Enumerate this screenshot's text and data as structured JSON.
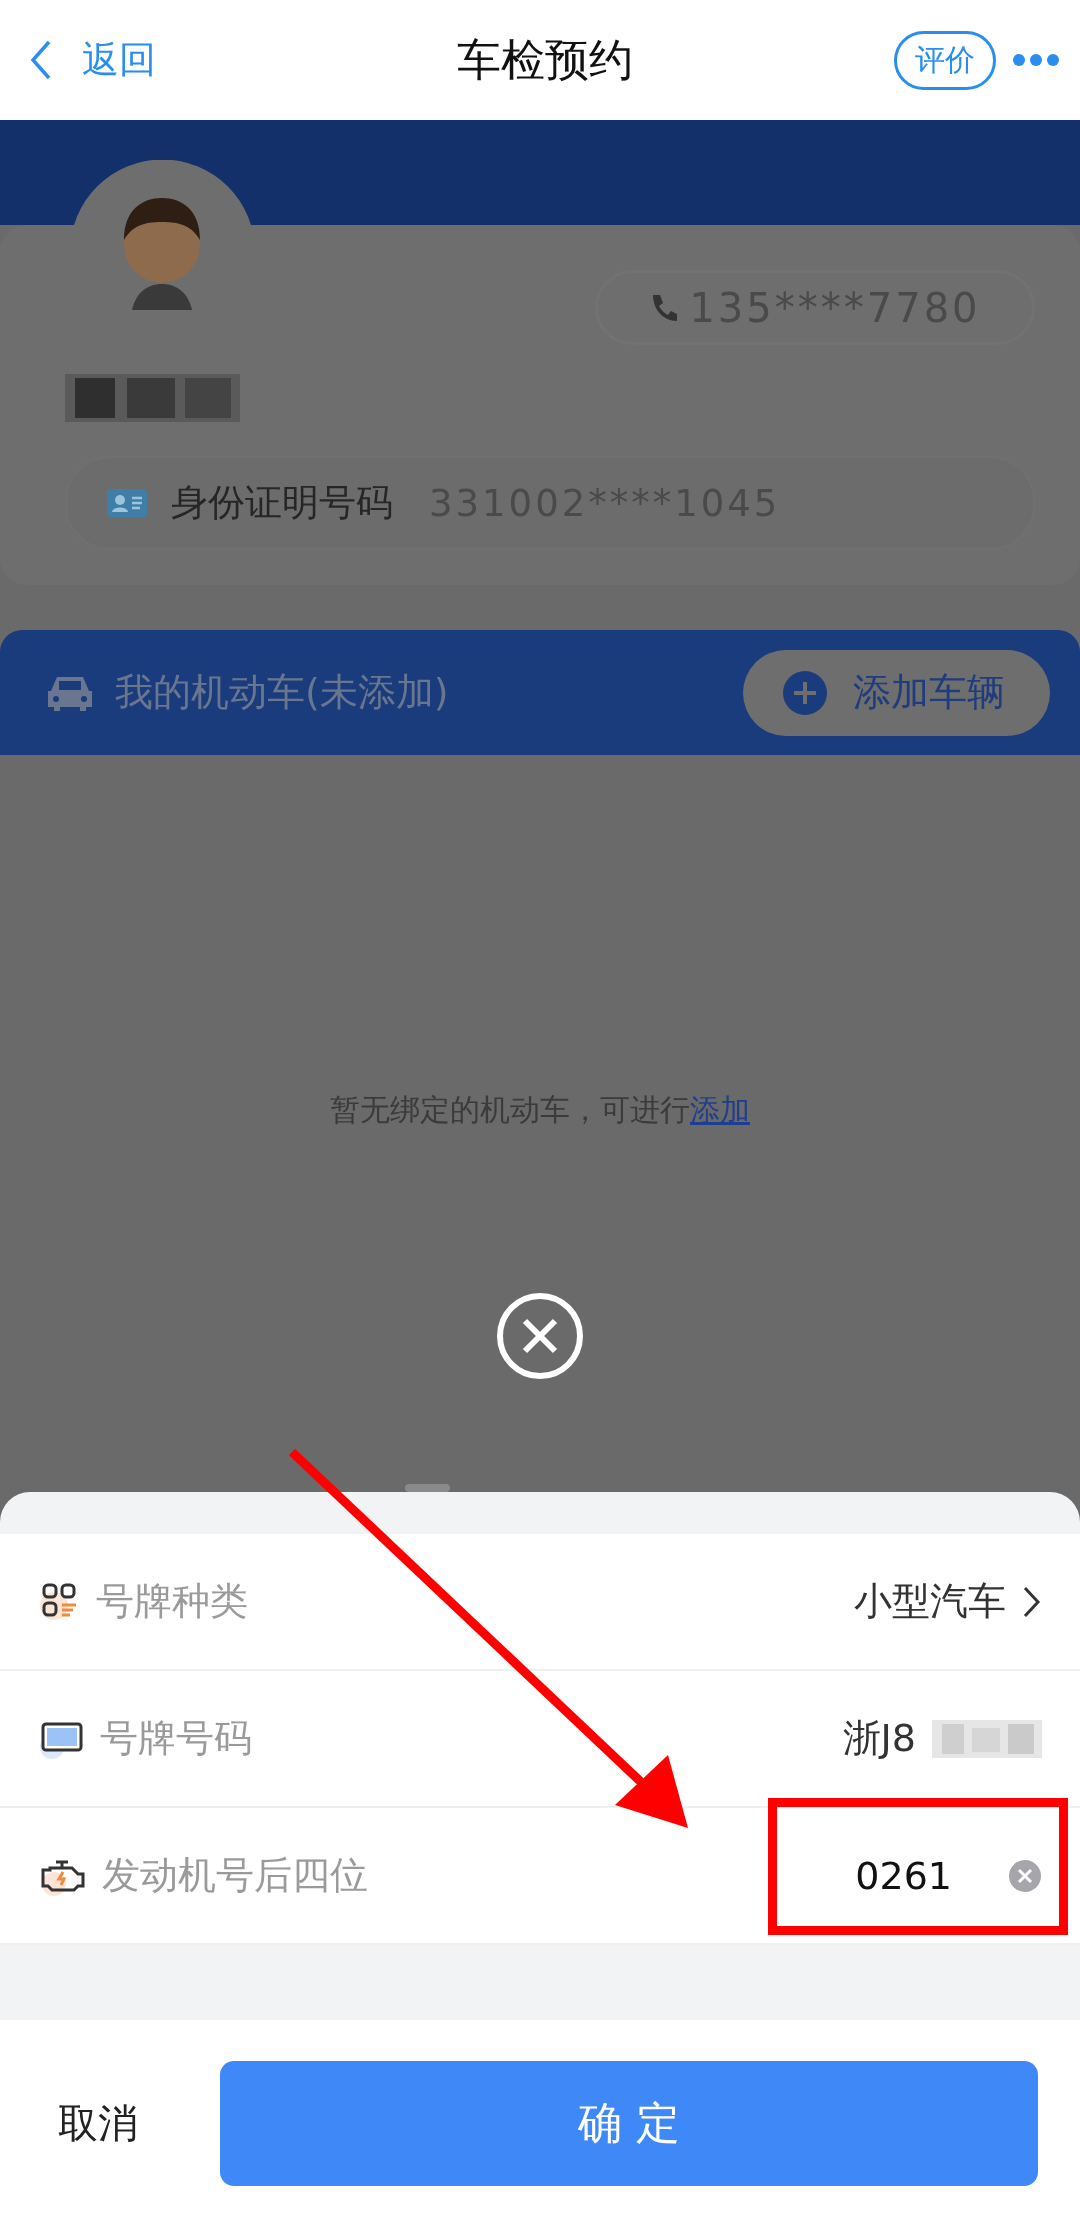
{
  "header": {
    "back": "返回",
    "title": "车检预约",
    "rate_button": "评价"
  },
  "profile": {
    "phone": "135****7780",
    "id_label": "身份证明号码",
    "id_value": "331002****1045"
  },
  "vehicles": {
    "title": "我的机动车(未添加)",
    "add_button": "添加车辆",
    "empty_text": "暂无绑定的机动车，可进行",
    "empty_link": "添加"
  },
  "sheet": {
    "rows": [
      {
        "kind": "select",
        "label": "号牌种类",
        "value": "小型汽车"
      },
      {
        "kind": "masked",
        "label": "号牌号码",
        "value": "浙J8"
      },
      {
        "kind": "input",
        "label": "发动机号后四位",
        "value": "0261"
      }
    ],
    "cancel": "取消",
    "confirm": "确 定"
  }
}
